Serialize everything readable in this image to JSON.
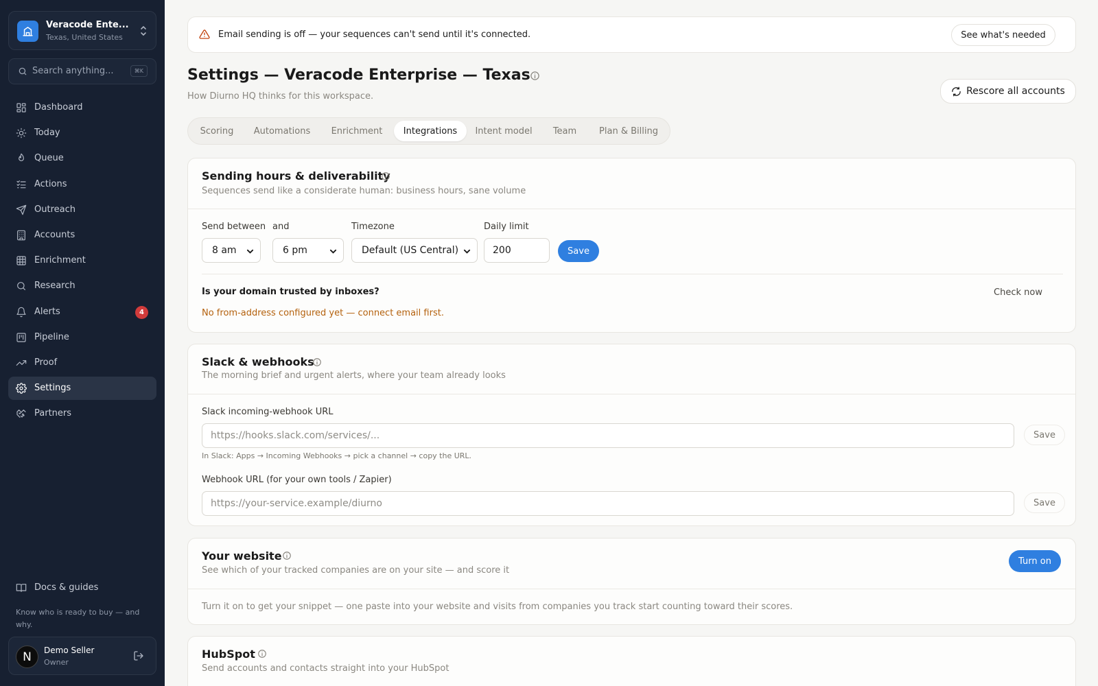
{
  "workspace": {
    "name": "Veracode Ente...",
    "location": "Texas, United States"
  },
  "search": {
    "placeholder": "Search anything...",
    "shortcut": "⌘K"
  },
  "nav": [
    {
      "label": "Dashboard",
      "icon": "grid-icon"
    },
    {
      "label": "Today",
      "icon": "sun-icon"
    },
    {
      "label": "Queue",
      "icon": "flame-icon"
    },
    {
      "label": "Actions",
      "icon": "list-check-icon"
    },
    {
      "label": "Outreach",
      "icon": "send-icon"
    },
    {
      "label": "Accounts",
      "icon": "building-icon"
    },
    {
      "label": "Enrichment",
      "icon": "table-icon"
    },
    {
      "label": "Research",
      "icon": "search-icon"
    },
    {
      "label": "Alerts",
      "icon": "bell-icon",
      "badge": "4"
    },
    {
      "label": "Pipeline",
      "icon": "kanban-icon"
    },
    {
      "label": "Proof",
      "icon": "trend-icon"
    },
    {
      "label": "Settings",
      "icon": "gear-icon",
      "active": true
    },
    {
      "label": "Partners",
      "icon": "handshake-icon"
    }
  ],
  "docs": {
    "label": "Docs & guides"
  },
  "tagline": "Know who is ready to buy — and why.",
  "user": {
    "name": "Demo Seller",
    "role": "Owner",
    "initial": "N"
  },
  "banner": {
    "text": "Email sending is off — your sequences can't send until it's connected.",
    "action": "See what's needed"
  },
  "page": {
    "title": "Settings — Veracode Enterprise — Texas",
    "subtitle": "How Diurno HQ thinks for this workspace.",
    "rescore": "Rescore all accounts"
  },
  "tabs": [
    {
      "label": "Scoring"
    },
    {
      "label": "Automations"
    },
    {
      "label": "Enrichment"
    },
    {
      "label": "Integrations",
      "active": true
    },
    {
      "label": "Intent model"
    },
    {
      "label": "Team"
    },
    {
      "label": "Plan & Billing"
    }
  ],
  "sending": {
    "title": "Sending hours & deliverability",
    "subtitle": "Sequences send like a considerate human: business hours, sane volume",
    "send_between_label": "Send between",
    "start": "8 am",
    "and_label": "and",
    "end": "6 pm",
    "timezone_label": "Timezone",
    "timezone": "Default (US Central)",
    "daily_limit_label": "Daily limit",
    "daily_limit": "200",
    "save": "Save",
    "domain_question": "Is your domain trusted by inboxes?",
    "check_now": "Check now",
    "warning": "No from-address configured yet — connect email first."
  },
  "slack": {
    "title": "Slack & webhooks",
    "subtitle": "The morning brief and urgent alerts, where your team already looks",
    "slack_label": "Slack incoming-webhook URL",
    "slack_placeholder": "https://hooks.slack.com/services/...",
    "slack_hint": "In Slack: Apps → Incoming Webhooks → pick a channel → copy the URL.",
    "webhook_label": "Webhook URL (for your own tools / Zapier)",
    "webhook_placeholder": "https://your-service.example/diurno",
    "save": "Save"
  },
  "website": {
    "title": "Your website",
    "subtitle": "See which of your tracked companies are on your site — and score it",
    "action": "Turn on",
    "body": "Turn it on to get your snippet — one paste into your website and visits from companies you track start counting toward their scores."
  },
  "hubspot": {
    "title": "HubSpot",
    "subtitle": "Send accounts and contacts straight into your HubSpot"
  },
  "colors": {
    "sidebar": "#172031",
    "accent": "#2f7fe0",
    "warning": "#b4610d",
    "badge": "#d13b3b"
  }
}
